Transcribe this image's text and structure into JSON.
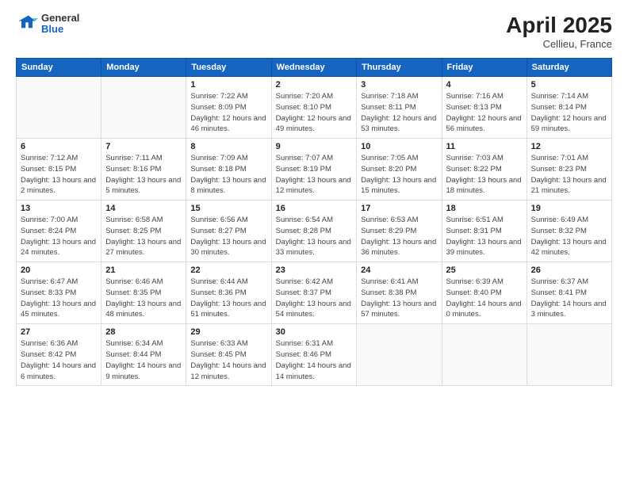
{
  "header": {
    "logo_general": "General",
    "logo_blue": "Blue",
    "title": "April 2025",
    "location": "Cellieu, France"
  },
  "weekdays": [
    "Sunday",
    "Monday",
    "Tuesday",
    "Wednesday",
    "Thursday",
    "Friday",
    "Saturday"
  ],
  "weeks": [
    [
      {
        "day": "",
        "info": ""
      },
      {
        "day": "",
        "info": ""
      },
      {
        "day": "1",
        "info": "Sunrise: 7:22 AM\nSunset: 8:09 PM\nDaylight: 12 hours and 46 minutes."
      },
      {
        "day": "2",
        "info": "Sunrise: 7:20 AM\nSunset: 8:10 PM\nDaylight: 12 hours and 49 minutes."
      },
      {
        "day": "3",
        "info": "Sunrise: 7:18 AM\nSunset: 8:11 PM\nDaylight: 12 hours and 53 minutes."
      },
      {
        "day": "4",
        "info": "Sunrise: 7:16 AM\nSunset: 8:13 PM\nDaylight: 12 hours and 56 minutes."
      },
      {
        "day": "5",
        "info": "Sunrise: 7:14 AM\nSunset: 8:14 PM\nDaylight: 12 hours and 59 minutes."
      }
    ],
    [
      {
        "day": "6",
        "info": "Sunrise: 7:12 AM\nSunset: 8:15 PM\nDaylight: 13 hours and 2 minutes."
      },
      {
        "day": "7",
        "info": "Sunrise: 7:11 AM\nSunset: 8:16 PM\nDaylight: 13 hours and 5 minutes."
      },
      {
        "day": "8",
        "info": "Sunrise: 7:09 AM\nSunset: 8:18 PM\nDaylight: 13 hours and 8 minutes."
      },
      {
        "day": "9",
        "info": "Sunrise: 7:07 AM\nSunset: 8:19 PM\nDaylight: 13 hours and 12 minutes."
      },
      {
        "day": "10",
        "info": "Sunrise: 7:05 AM\nSunset: 8:20 PM\nDaylight: 13 hours and 15 minutes."
      },
      {
        "day": "11",
        "info": "Sunrise: 7:03 AM\nSunset: 8:22 PM\nDaylight: 13 hours and 18 minutes."
      },
      {
        "day": "12",
        "info": "Sunrise: 7:01 AM\nSunset: 8:23 PM\nDaylight: 13 hours and 21 minutes."
      }
    ],
    [
      {
        "day": "13",
        "info": "Sunrise: 7:00 AM\nSunset: 8:24 PM\nDaylight: 13 hours and 24 minutes."
      },
      {
        "day": "14",
        "info": "Sunrise: 6:58 AM\nSunset: 8:25 PM\nDaylight: 13 hours and 27 minutes."
      },
      {
        "day": "15",
        "info": "Sunrise: 6:56 AM\nSunset: 8:27 PM\nDaylight: 13 hours and 30 minutes."
      },
      {
        "day": "16",
        "info": "Sunrise: 6:54 AM\nSunset: 8:28 PM\nDaylight: 13 hours and 33 minutes."
      },
      {
        "day": "17",
        "info": "Sunrise: 6:53 AM\nSunset: 8:29 PM\nDaylight: 13 hours and 36 minutes."
      },
      {
        "day": "18",
        "info": "Sunrise: 6:51 AM\nSunset: 8:31 PM\nDaylight: 13 hours and 39 minutes."
      },
      {
        "day": "19",
        "info": "Sunrise: 6:49 AM\nSunset: 8:32 PM\nDaylight: 13 hours and 42 minutes."
      }
    ],
    [
      {
        "day": "20",
        "info": "Sunrise: 6:47 AM\nSunset: 8:33 PM\nDaylight: 13 hours and 45 minutes."
      },
      {
        "day": "21",
        "info": "Sunrise: 6:46 AM\nSunset: 8:35 PM\nDaylight: 13 hours and 48 minutes."
      },
      {
        "day": "22",
        "info": "Sunrise: 6:44 AM\nSunset: 8:36 PM\nDaylight: 13 hours and 51 minutes."
      },
      {
        "day": "23",
        "info": "Sunrise: 6:42 AM\nSunset: 8:37 PM\nDaylight: 13 hours and 54 minutes."
      },
      {
        "day": "24",
        "info": "Sunrise: 6:41 AM\nSunset: 8:38 PM\nDaylight: 13 hours and 57 minutes."
      },
      {
        "day": "25",
        "info": "Sunrise: 6:39 AM\nSunset: 8:40 PM\nDaylight: 14 hours and 0 minutes."
      },
      {
        "day": "26",
        "info": "Sunrise: 6:37 AM\nSunset: 8:41 PM\nDaylight: 14 hours and 3 minutes."
      }
    ],
    [
      {
        "day": "27",
        "info": "Sunrise: 6:36 AM\nSunset: 8:42 PM\nDaylight: 14 hours and 6 minutes."
      },
      {
        "day": "28",
        "info": "Sunrise: 6:34 AM\nSunset: 8:44 PM\nDaylight: 14 hours and 9 minutes."
      },
      {
        "day": "29",
        "info": "Sunrise: 6:33 AM\nSunset: 8:45 PM\nDaylight: 14 hours and 12 minutes."
      },
      {
        "day": "30",
        "info": "Sunrise: 6:31 AM\nSunset: 8:46 PM\nDaylight: 14 hours and 14 minutes."
      },
      {
        "day": "",
        "info": ""
      },
      {
        "day": "",
        "info": ""
      },
      {
        "day": "",
        "info": ""
      }
    ]
  ]
}
